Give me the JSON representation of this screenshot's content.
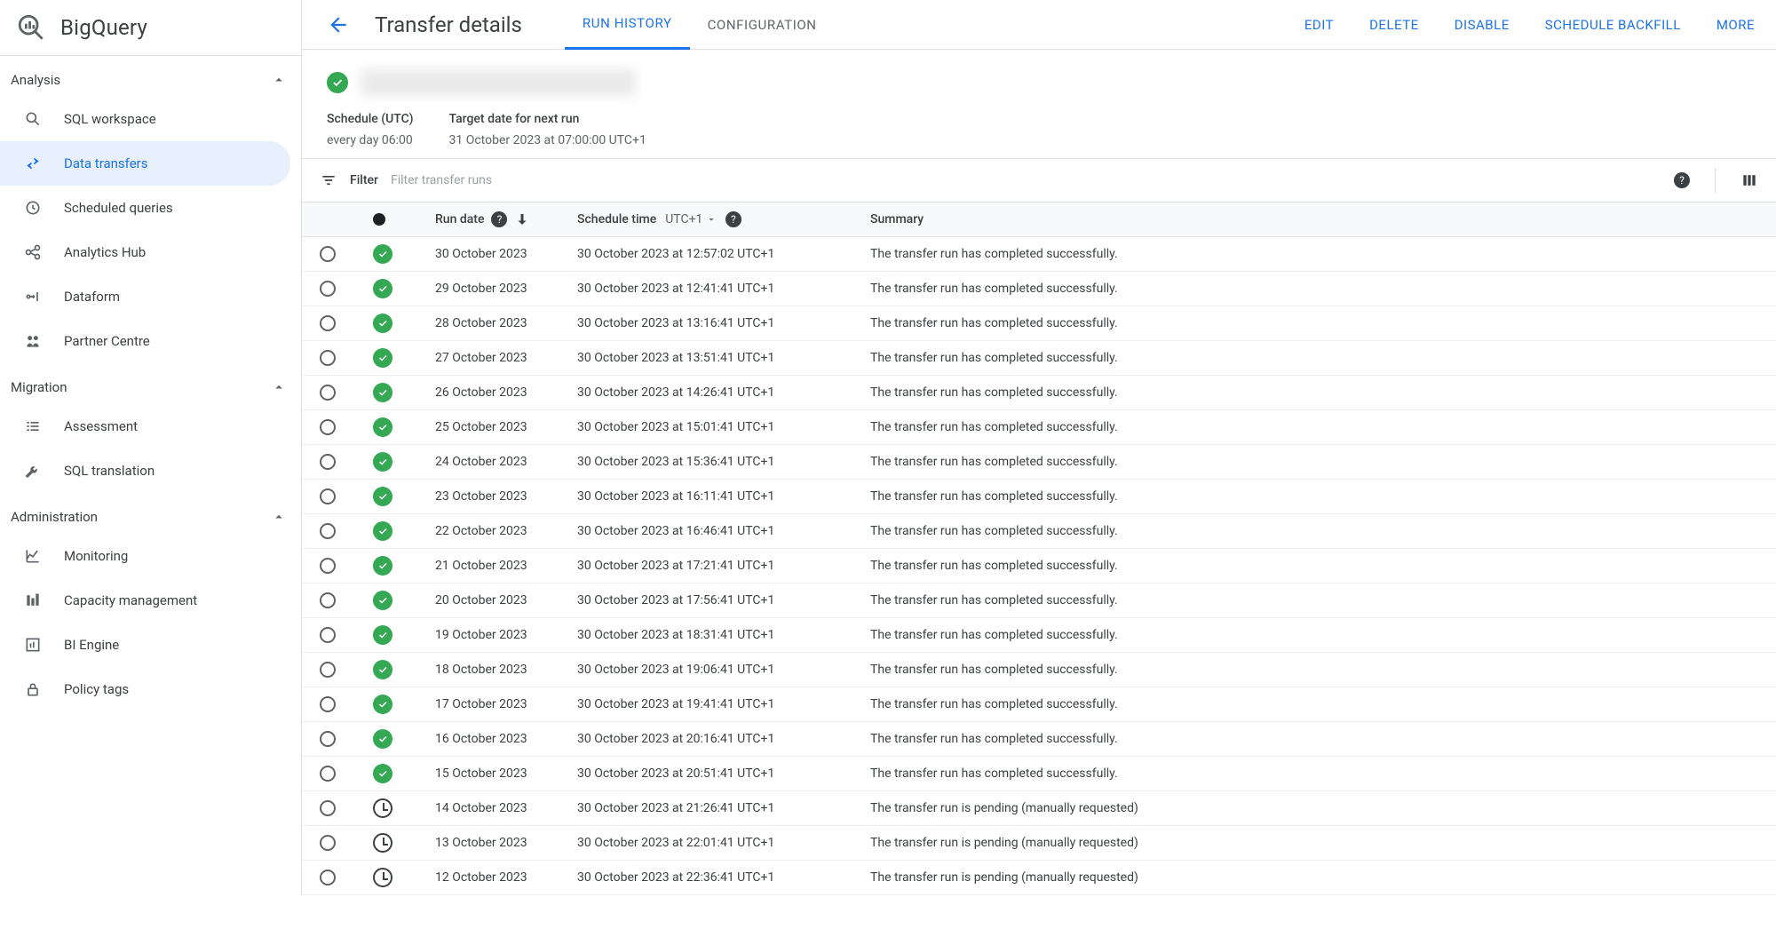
{
  "brand": {
    "name": "BigQuery"
  },
  "sidebar": {
    "sections": {
      "analysis": {
        "label": "Analysis",
        "items": [
          {
            "label": "SQL workspace"
          },
          {
            "label": "Data transfers"
          },
          {
            "label": "Scheduled queries"
          },
          {
            "label": "Analytics Hub"
          },
          {
            "label": "Dataform"
          },
          {
            "label": "Partner Centre"
          }
        ]
      },
      "migration": {
        "label": "Migration",
        "items": [
          {
            "label": "Assessment"
          },
          {
            "label": "SQL translation"
          }
        ]
      },
      "administration": {
        "label": "Administration",
        "items": [
          {
            "label": "Monitoring"
          },
          {
            "label": "Capacity management"
          },
          {
            "label": "BI Engine"
          },
          {
            "label": "Policy tags"
          }
        ]
      }
    }
  },
  "header": {
    "title": "Transfer details",
    "tabs": {
      "run_history": "RUN HISTORY",
      "configuration": "CONFIGURATION"
    },
    "actions": {
      "edit": "EDIT",
      "delete": "DELETE",
      "disable": "DISABLE",
      "schedule_backfill": "SCHEDULE BACKFILL",
      "more": "MORE"
    }
  },
  "details": {
    "schedule_label": "Schedule (UTC)",
    "schedule_value": "every day 06:00",
    "target_label": "Target date for next run",
    "target_value": "31 October 2023 at 07:00:00 UTC+1"
  },
  "filter": {
    "label": "Filter",
    "placeholder": "Filter transfer runs"
  },
  "table": {
    "headers": {
      "run_date": "Run date",
      "schedule_time": "Schedule time",
      "timezone": "UTC+1",
      "summary": "Summary"
    },
    "success_summary": "The transfer run has completed successfully.",
    "pending_summary": "The transfer run is pending (manually requested)",
    "runs": [
      {
        "status": "success",
        "run_date": "30 October 2023",
        "schedule_time": "30 October 2023 at 12:57:02 UTC+1"
      },
      {
        "status": "success",
        "run_date": "29 October 2023",
        "schedule_time": "30 October 2023 at 12:41:41 UTC+1"
      },
      {
        "status": "success",
        "run_date": "28 October 2023",
        "schedule_time": "30 October 2023 at 13:16:41 UTC+1"
      },
      {
        "status": "success",
        "run_date": "27 October 2023",
        "schedule_time": "30 October 2023 at 13:51:41 UTC+1"
      },
      {
        "status": "success",
        "run_date": "26 October 2023",
        "schedule_time": "30 October 2023 at 14:26:41 UTC+1"
      },
      {
        "status": "success",
        "run_date": "25 October 2023",
        "schedule_time": "30 October 2023 at 15:01:41 UTC+1"
      },
      {
        "status": "success",
        "run_date": "24 October 2023",
        "schedule_time": "30 October 2023 at 15:36:41 UTC+1"
      },
      {
        "status": "success",
        "run_date": "23 October 2023",
        "schedule_time": "30 October 2023 at 16:11:41 UTC+1"
      },
      {
        "status": "success",
        "run_date": "22 October 2023",
        "schedule_time": "30 October 2023 at 16:46:41 UTC+1"
      },
      {
        "status": "success",
        "run_date": "21 October 2023",
        "schedule_time": "30 October 2023 at 17:21:41 UTC+1"
      },
      {
        "status": "success",
        "run_date": "20 October 2023",
        "schedule_time": "30 October 2023 at 17:56:41 UTC+1"
      },
      {
        "status": "success",
        "run_date": "19 October 2023",
        "schedule_time": "30 October 2023 at 18:31:41 UTC+1"
      },
      {
        "status": "success",
        "run_date": "18 October 2023",
        "schedule_time": "30 October 2023 at 19:06:41 UTC+1"
      },
      {
        "status": "success",
        "run_date": "17 October 2023",
        "schedule_time": "30 October 2023 at 19:41:41 UTC+1"
      },
      {
        "status": "success",
        "run_date": "16 October 2023",
        "schedule_time": "30 October 2023 at 20:16:41 UTC+1"
      },
      {
        "status": "success",
        "run_date": "15 October 2023",
        "schedule_time": "30 October 2023 at 20:51:41 UTC+1"
      },
      {
        "status": "pending",
        "run_date": "14 October 2023",
        "schedule_time": "30 October 2023 at 21:26:41 UTC+1"
      },
      {
        "status": "pending",
        "run_date": "13 October 2023",
        "schedule_time": "30 October 2023 at 22:01:41 UTC+1"
      },
      {
        "status": "pending",
        "run_date": "12 October 2023",
        "schedule_time": "30 October 2023 at 22:36:41 UTC+1"
      }
    ]
  }
}
